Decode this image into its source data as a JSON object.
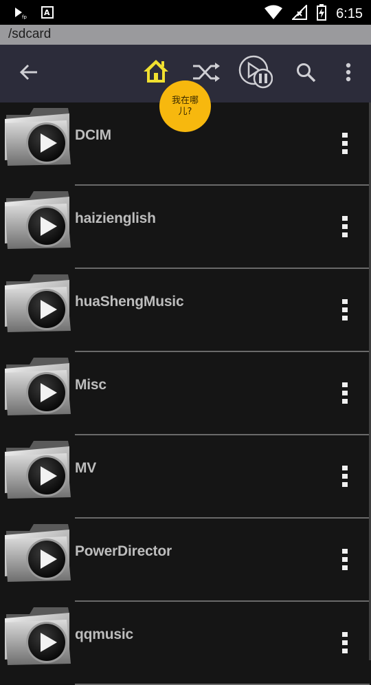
{
  "status_bar": {
    "time": "6:15",
    "left_icons": [
      "play-fp-icon",
      "a-text-icon"
    ],
    "right_icons": [
      "wifi-icon",
      "signal-icon",
      "battery-charging-icon"
    ]
  },
  "path": "/sdcard",
  "toolbar": {
    "back": "back-arrow-icon",
    "home": "home-icon",
    "shuffle": "shuffle-icon",
    "play_pause": "play-pause-icon",
    "search": "search-icon",
    "more": "more-vert-icon",
    "home_color": "#f0e030"
  },
  "tooltip": {
    "text": "我在哪儿?"
  },
  "folders": [
    {
      "name": "DCIM"
    },
    {
      "name": "haizienglish"
    },
    {
      "name": "huaShengMusic"
    },
    {
      "name": "Misc"
    },
    {
      "name": "MV"
    },
    {
      "name": "PowerDirector"
    },
    {
      "name": "qqmusic"
    }
  ],
  "colors": {
    "toolbar_bg": "#2c2c3a",
    "path_bar_bg": "#9a9a9d",
    "list_bg": "#151515",
    "bubble_bg": "#f7b80e"
  }
}
